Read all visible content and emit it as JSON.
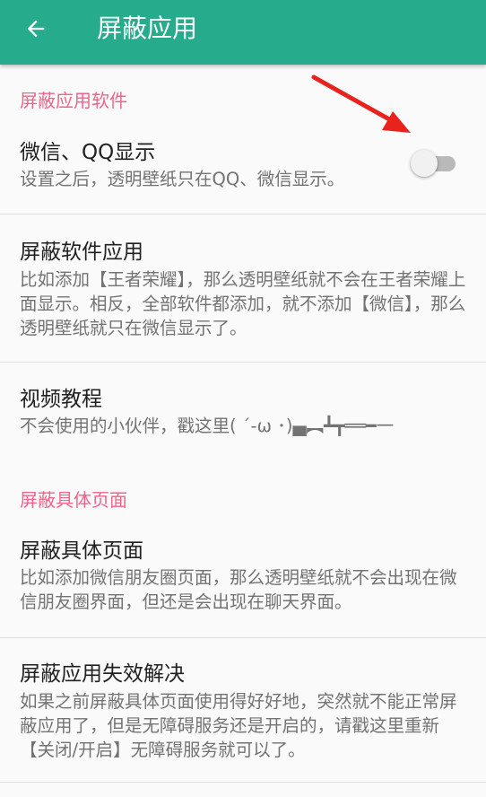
{
  "appbar": {
    "title": "屏蔽应用",
    "back_icon": "arrow-back-icon",
    "background_color": "#26ab8c"
  },
  "accent_color": "#f0648c",
  "sections": [
    {
      "header": "屏蔽应用软件"
    },
    {
      "header": "屏蔽具体页面"
    }
  ],
  "prefs": [
    {
      "title": "微信、QQ显示",
      "summary": "设置之后，透明壁纸只在QQ、微信显示。",
      "switch": {
        "checked": false
      }
    },
    {
      "title": "屏蔽软件应用",
      "summary": "比如添加【王者荣耀】，那么透明壁纸就不会在王者荣耀上面显示。相反，全部软件都添加，就不添加【微信】，那么透明壁纸就只在微信显示了。"
    },
    {
      "title": "视频教程",
      "summary": "不会使用的小伙伴，戳这里( ´-ω ･)▄︻┻┳══━一"
    },
    {
      "title": "屏蔽具体页面",
      "summary": "比如添加微信朋友圈页面，那么透明壁纸就不会出现在微信朋友圈界面，但还是会出现在聊天界面。"
    },
    {
      "title": "屏蔽应用失效解决",
      "summary": "如果之前屏蔽具体页面使用得好好地，突然就不能正常屏蔽应用了，但是无障碍服务还是开启的，请戳这里重新【关闭/开启】无障碍服务就可以了。"
    }
  ],
  "annotation": {
    "icon": "red-arrow-icon",
    "color": "#e8231e"
  }
}
